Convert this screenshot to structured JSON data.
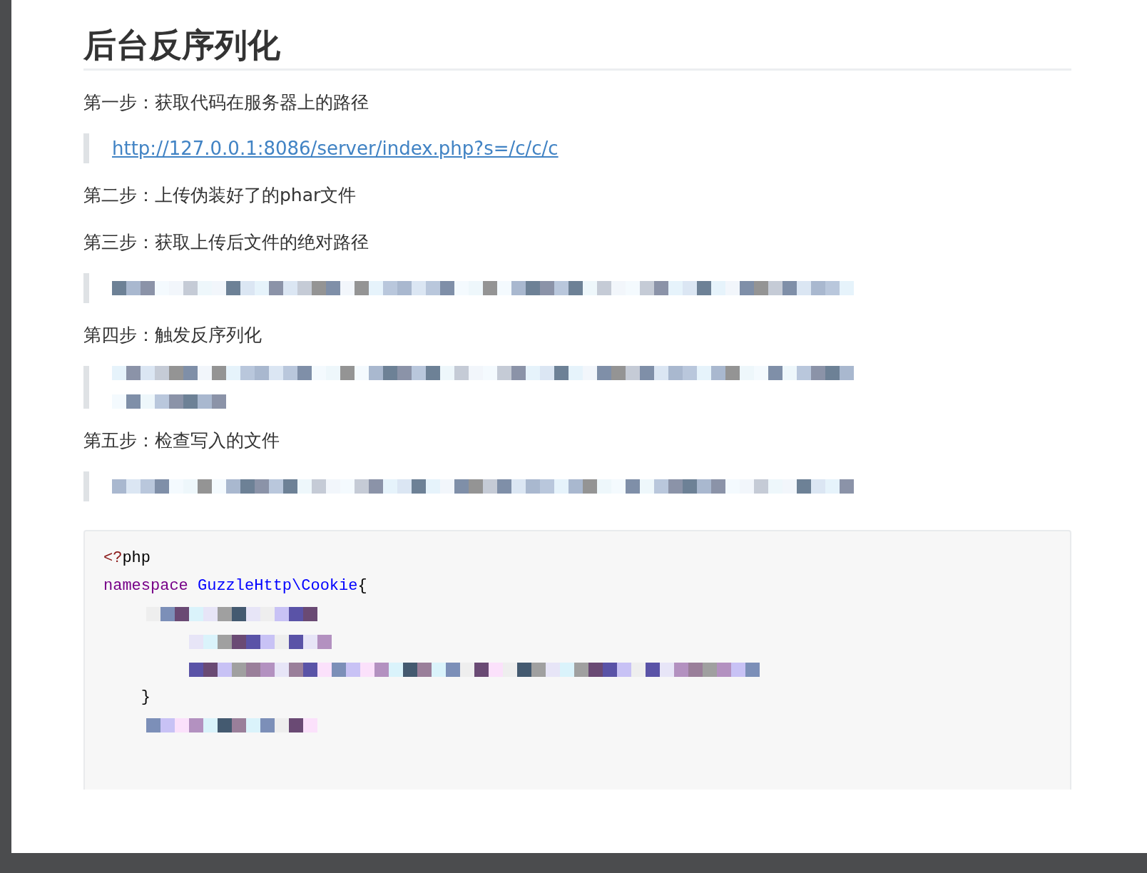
{
  "title": "后台反序列化",
  "blocks": [
    {
      "kind": "paragraph",
      "text": "第一步：获取代码在服务器上的路径"
    },
    {
      "kind": "link",
      "text": "http://127.0.0.1:8086/server/index.php?s=/c/c/c"
    },
    {
      "kind": "paragraph",
      "text": "第二步：上传伪装好了的phar文件"
    },
    {
      "kind": "paragraph",
      "text": "第三步：获取上传后文件的绝对路径"
    },
    {
      "kind": "redacted"
    },
    {
      "kind": "paragraph",
      "text": "第四步：触发反序列化"
    },
    {
      "kind": "redacted-double"
    },
    {
      "kind": "paragraph",
      "text": "第五步：检查写入的文件"
    },
    {
      "kind": "redacted"
    }
  ],
  "code": [
    {
      "kind": "tokens",
      "tokens": [
        {
          "kind": "meta",
          "text": "<?"
        },
        {
          "kind": "plain",
          "text": "php"
        }
      ]
    },
    {
      "kind": "tokens",
      "tokens": [
        {
          "kind": "keyword",
          "text": "namespace"
        },
        {
          "kind": "name",
          "text": "GuzzleHttp\\Cookie"
        },
        {
          "kind": "plain",
          "text": "{"
        }
      ]
    },
    {
      "kind": "redacted"
    },
    {
      "kind": "redacted"
    },
    {
      "kind": "redacted"
    },
    {
      "kind": "tokens",
      "tokens": [
        {
          "kind": "plain",
          "text": "    }"
        }
      ]
    },
    {
      "kind": "redacted"
    }
  ]
}
